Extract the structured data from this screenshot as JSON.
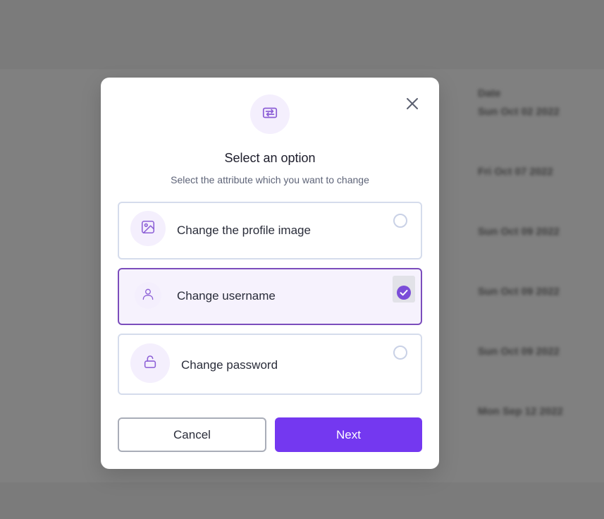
{
  "background": {
    "column_header": "Date",
    "dates": [
      "Sun Oct 02 2022",
      "Fri Oct 07 2022",
      "Sun Oct 09 2022",
      "Sun Oct 09 2022",
      "Sun Oct 09 2022",
      "Mon Sep 12 2022"
    ]
  },
  "modal": {
    "title": "Select an option",
    "subtitle": "Select the attribute which you want to change",
    "header_icon": "swap-arrows-icon",
    "close_icon": "close-icon",
    "options": [
      {
        "label": "Change the profile image",
        "icon": "image-icon",
        "selected": false
      },
      {
        "label": "Change username",
        "icon": "user-icon",
        "selected": true
      },
      {
        "label": "Change password",
        "icon": "unlock-icon",
        "selected": false
      }
    ],
    "cancel_label": "Cancel",
    "next_label": "Next"
  },
  "colors": {
    "accent": "#7438f0",
    "selected_border": "#7b4dbc",
    "icon_purple": "#8c5fd6",
    "overlay": "#7b7b7b"
  }
}
